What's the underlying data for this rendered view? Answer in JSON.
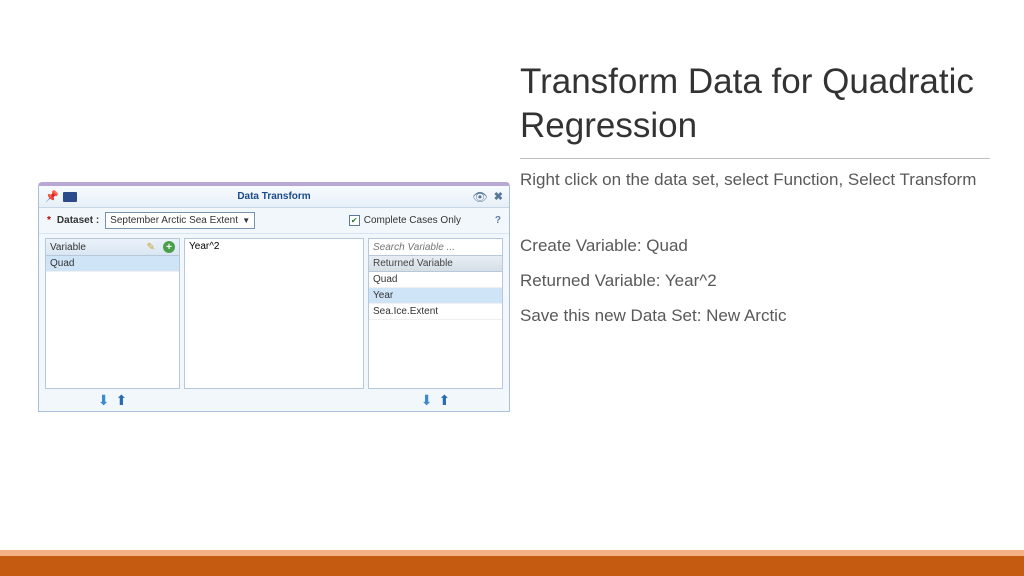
{
  "slide": {
    "title": "Transform Data for Quadratic Regression",
    "p1": "Right click on the data set, select Function, Select Transform",
    "p2": "Create Variable: Quad",
    "p3": "Returned Variable: Year^2",
    "p4": "Save this new Data Set: New Arctic"
  },
  "app": {
    "titlebar": "Data Transform",
    "dataset_label": "Dataset :",
    "dataset_value": "September Arctic Sea Extent",
    "complete_cases": "Complete Cases Only",
    "left_panel_header": "Variable",
    "left_items": [
      "Quad"
    ],
    "mid_value": "Year^2",
    "right_search_placeholder": "Search Variable ...",
    "right_returned_header": "Returned Variable",
    "right_items": [
      "Quad",
      "Year",
      "Sea.Ice.Extent"
    ],
    "right_selected_index": 1
  }
}
